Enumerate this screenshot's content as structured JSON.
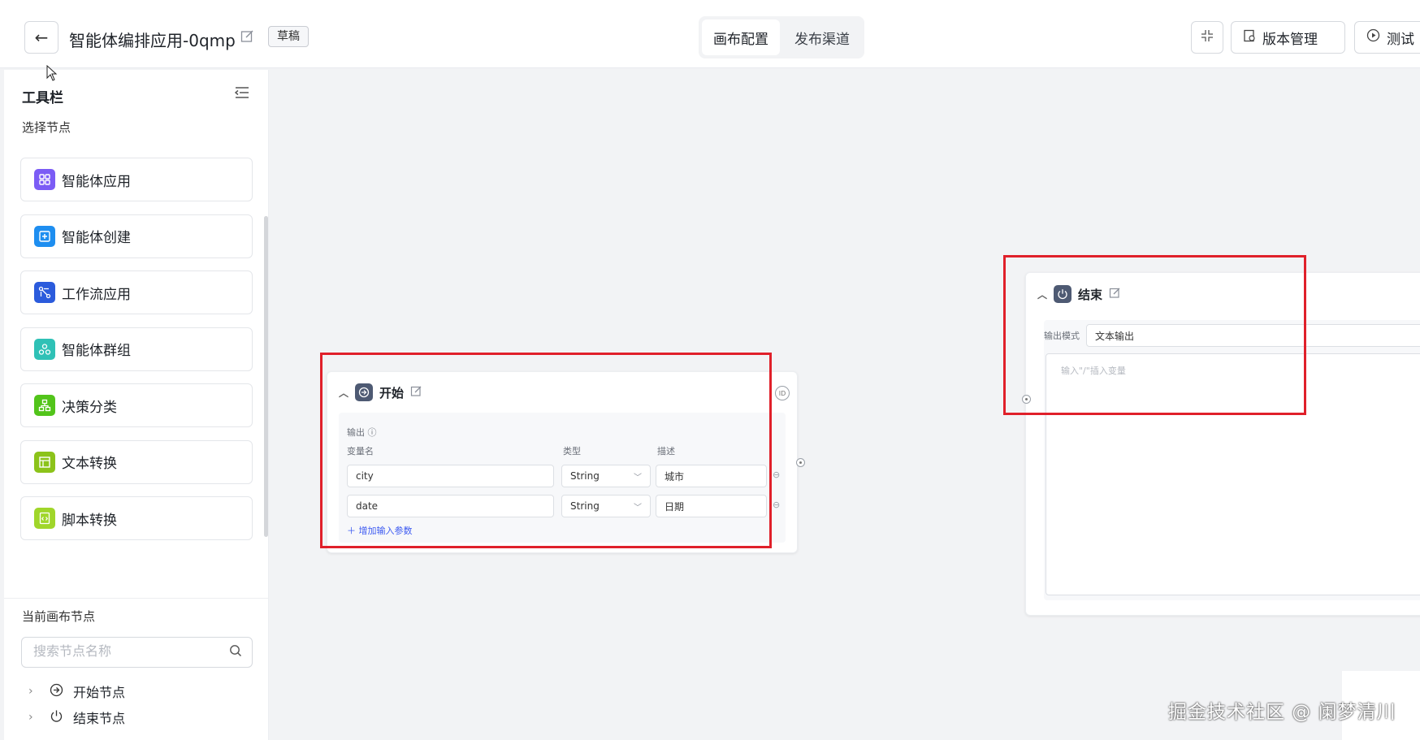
{
  "header": {
    "title": "智能体编排应用-0qmp",
    "status_badge": "草稿",
    "tabs": [
      {
        "label": "画布配置",
        "active": true
      },
      {
        "label": "发布渠道",
        "active": false
      }
    ],
    "version_button": "版本管理",
    "test_button": "测试"
  },
  "sidebar": {
    "toolbar_title": "工具栏",
    "select_nodes_title": "选择节点",
    "node_types": [
      {
        "label": "智能体应用",
        "color": "#7b5cf5",
        "icon": "apps-grid-icon"
      },
      {
        "label": "智能体创建",
        "color": "#1e8ef0",
        "icon": "plus-square-icon"
      },
      {
        "label": "工作流应用",
        "color": "#2b5bdc",
        "icon": "workflow-icon"
      },
      {
        "label": "智能体群组",
        "color": "#2fc1b6",
        "icon": "group-icon"
      },
      {
        "label": "决策分类",
        "color": "#52c41a",
        "icon": "decision-tree-icon"
      },
      {
        "label": "文本转换",
        "color": "#8cc31a",
        "icon": "text-transform-icon"
      },
      {
        "label": "脚本转换",
        "color": "#a0d62a",
        "icon": "script-icon"
      }
    ],
    "current_nodes_title": "当前画布节点",
    "search_placeholder": "搜索节点名称",
    "tree": [
      {
        "label": "开始节点",
        "icon": "start-icon"
      },
      {
        "label": "结束节点",
        "icon": "power-icon"
      }
    ]
  },
  "start_node": {
    "title": "开始",
    "output_label": "输出",
    "columns": {
      "name": "变量名",
      "type": "类型",
      "desc": "描述"
    },
    "params": [
      {
        "name": "city",
        "type": "String",
        "desc": "城市"
      },
      {
        "name": "date",
        "type": "String",
        "desc": "日期"
      }
    ],
    "add_param": "增加输入参数"
  },
  "end_node": {
    "title": "结束",
    "output_mode_label": "输出模式",
    "output_mode_value": "文本输出",
    "input_placeholder": "输入\"/\"插入变量"
  },
  "watermark": "掘金技术社区 @ 阑梦清川",
  "colors": {
    "highlight": "#e0202a",
    "accent": "#3d5af1"
  }
}
